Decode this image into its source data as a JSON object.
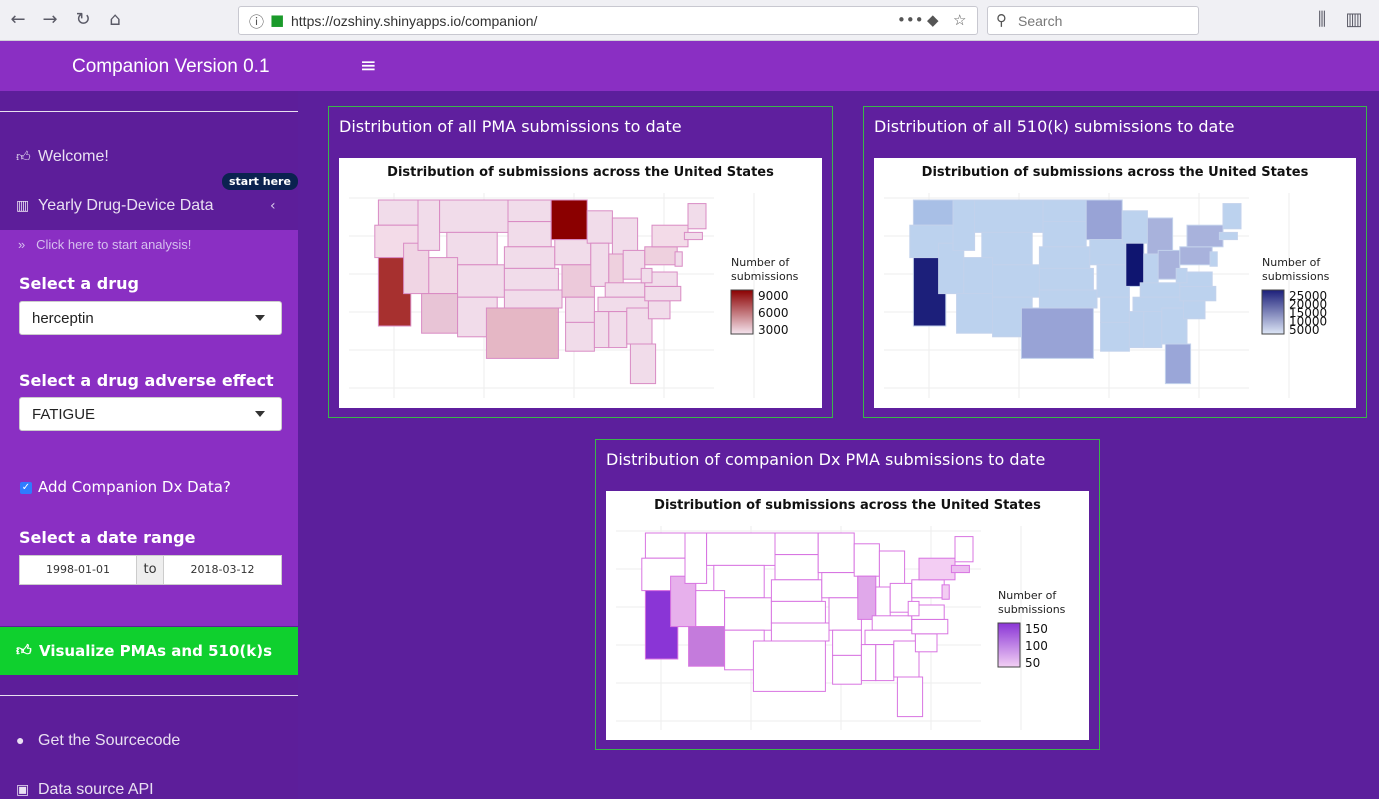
{
  "browser": {
    "url": "https://ozshiny.shinyapps.io/companion/",
    "search_placeholder": "Search"
  },
  "header": {
    "title": "Companion Version 0.1"
  },
  "sidebar": {
    "welcome": "Welcome!",
    "yearly": "Yearly Drug-Device Data",
    "start_badge": "start here",
    "start_link": "Click here to start analysis!",
    "drug_label": "Select a drug",
    "drug_value": "herceptin",
    "effect_label": "Select a drug adverse effect",
    "effect_value": "FATIGUE",
    "companion_label": "Add Companion Dx Data?",
    "date_label": "Select a date range",
    "date_start": "1998-01-01",
    "date_to": "to",
    "date_end": "2018-03-12",
    "visualize_button": "Visualize PMAs and 510(k)s",
    "sourcecode": "Get the Sourcecode",
    "api": "Data source API"
  },
  "panels": {
    "pma": {
      "title": "Distribution of all PMA submissions to date",
      "chart_title": "Distribution of submissions across the United States",
      "legend_title_1": "Number of",
      "legend_title_2": "submissions",
      "ticks": [
        "9000",
        "6000",
        "3000"
      ],
      "colors": [
        "#8b0000",
        "#f5e4ee"
      ]
    },
    "k510": {
      "title": "Distribution of all 510(k) submissions to date",
      "chart_title": "Distribution of submissions across the United States",
      "legend_title_1": "Number of",
      "legend_title_2": "submissions",
      "ticks": [
        "25000",
        "20000",
        "15000",
        "10000",
        "5000"
      ],
      "colors": [
        "#1c1f7a",
        "#dde6f6"
      ]
    },
    "cdx": {
      "title": "Distribution of companion Dx PMA submissions to date",
      "chart_title": "Distribution of submissions across the United States",
      "legend_title_1": "Number of",
      "legend_title_2": "submissions",
      "ticks": [
        "150",
        "100",
        "50"
      ],
      "colors": [
        "#8a35d6",
        "#f3d0f4"
      ]
    }
  },
  "chart_data": [
    {
      "type": "heatmap",
      "title": "Distribution of submissions across the United States",
      "legend": "Number of submissions",
      "ticks": [
        9000,
        6000,
        3000
      ],
      "highlights": {
        "Minnesota": 9000,
        "California": 8000,
        "Texas": 3000
      }
    },
    {
      "type": "heatmap",
      "title": "Distribution of submissions across the United States",
      "legend": "Number of submissions",
      "ticks": [
        25000,
        20000,
        15000,
        10000,
        5000
      ],
      "highlights": {
        "California": 25000,
        "Illinois": 25000,
        "Minnesota": 9000,
        "Texas": 9000
      }
    },
    {
      "type": "heatmap",
      "title": "Distribution of submissions across the United States",
      "legend": "Number of submissions",
      "ticks": [
        150,
        100,
        50
      ],
      "highlights": {
        "California": 150,
        "Arizona": 100,
        "Illinois": 60,
        "Massachusetts": 50
      }
    }
  ]
}
